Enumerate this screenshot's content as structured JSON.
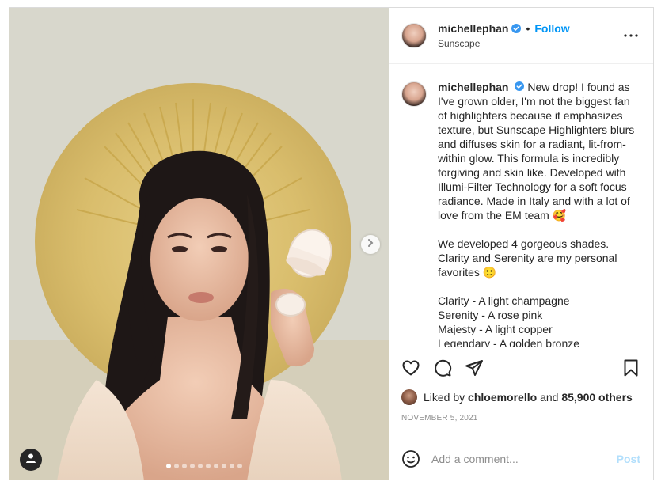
{
  "post": {
    "username": "michellephan",
    "follow_label": "Follow",
    "separator": "•",
    "location": "Sunscape",
    "caption_paragraphs": [
      "New drop! I found as I've grown older, I'm not the biggest fan of highlighters because it emphasizes texture, but Sunscape Highlighters blurs and diffuses skin for a radiant, lit-from-within glow. This formula is incredibly forgiving and skin like. Developed with Illumi-Filter Technology for a soft focus radiance. Made in Italy and with a lot of love from the EM team 🥰",
      "We developed 4 gorgeous shades. Clarity and Serenity are my personal favorites 🙂"
    ],
    "shades": [
      "Clarity - A light champagne",
      "Serenity - A rose pink",
      "Majesty - A light copper",
      "Legendary - A golden bronze"
    ],
    "liked_prefix": "Liked by",
    "liked_user": "chloemorello",
    "liked_and": "and",
    "liked_count": "85,900 others",
    "date": "NOVEMBER 5, 2021",
    "comment_placeholder": "Add a comment...",
    "post_label": "Post",
    "carousel": {
      "total": 10,
      "active": 1
    }
  },
  "icons": {
    "verified": "verified-badge-icon",
    "more": "more-options-icon",
    "like": "heart-icon",
    "comment": "comment-icon",
    "share": "paper-plane-icon",
    "save": "bookmark-icon",
    "emoji": "emoji-icon",
    "next": "chevron-right-icon",
    "tag": "user-tag-icon"
  },
  "colors": {
    "accent": "#0095f6",
    "post_disabled": "#b2dffc",
    "text": "#262626",
    "muted": "#8e8e8e"
  }
}
